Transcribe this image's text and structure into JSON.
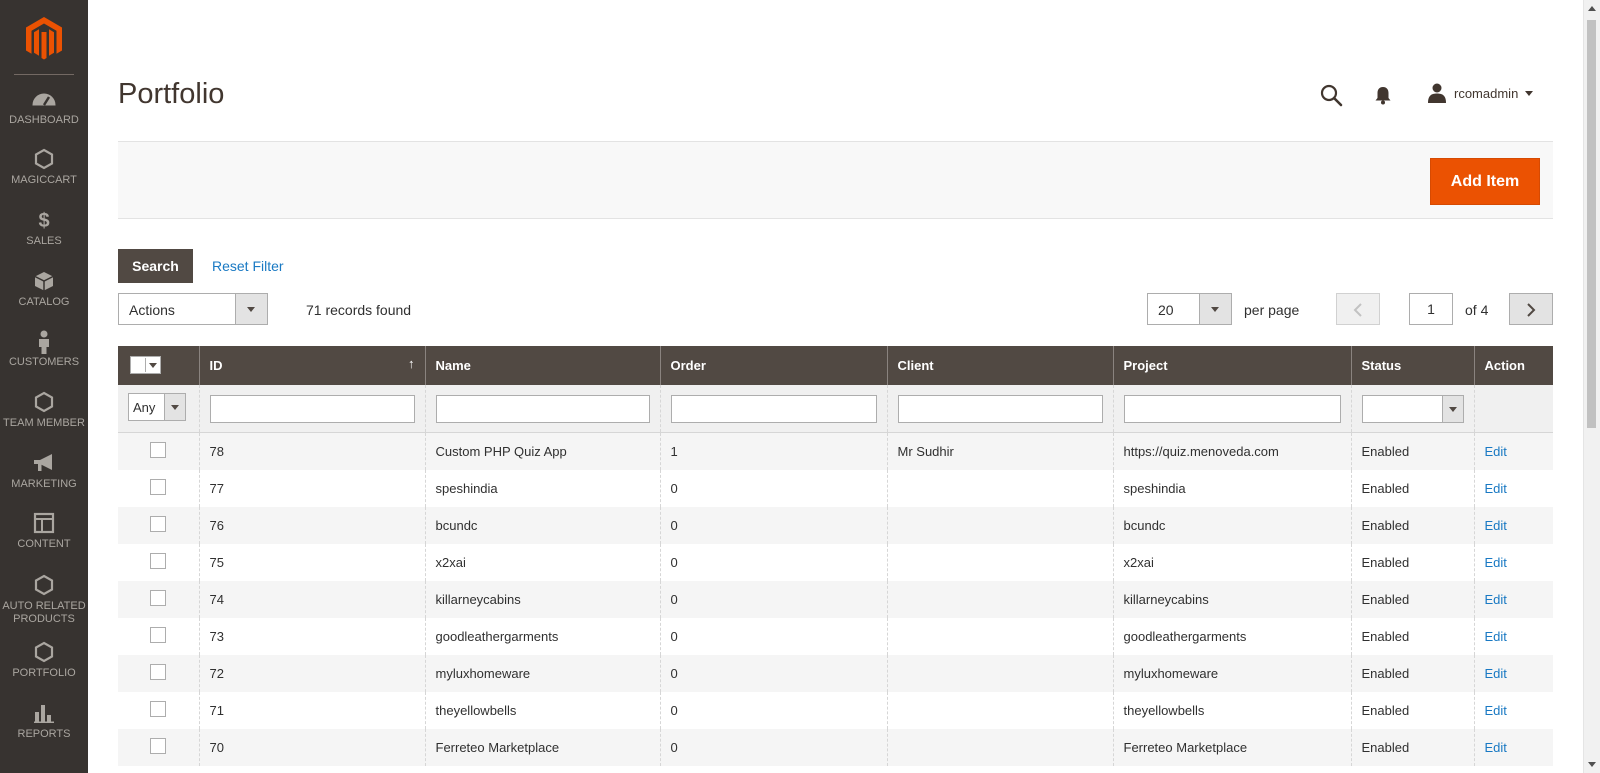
{
  "sidebar": {
    "items": [
      {
        "label": "DASHBOARD",
        "icon": "dashboard-icon"
      },
      {
        "label": "MAGICCART",
        "icon": "hexagon-icon"
      },
      {
        "label": "SALES",
        "icon": "dollar-icon"
      },
      {
        "label": "CATALOG",
        "icon": "box-icon"
      },
      {
        "label": "CUSTOMERS",
        "icon": "person-icon"
      },
      {
        "label": "TEAM MEMBER",
        "icon": "hexagon-icon"
      },
      {
        "label": "MARKETING",
        "icon": "megaphone-icon"
      },
      {
        "label": "CONTENT",
        "icon": "layout-icon"
      },
      {
        "label": "AUTO RELATED PRODUCTS",
        "icon": "hexagon-icon"
      },
      {
        "label": "PORTFOLIO",
        "icon": "hexagon-icon"
      },
      {
        "label": "REPORTS",
        "icon": "bar-chart-icon"
      }
    ]
  },
  "header": {
    "title": "Portfolio",
    "username": "rcomadmin"
  },
  "toolbar": {
    "add_label": "Add Item",
    "search_label": "Search",
    "reset_label": "Reset Filter",
    "actions_label": "Actions",
    "records": "71 records found",
    "per_page_value": "20",
    "per_page_label": "per page",
    "page": "1",
    "page_of": "of 4"
  },
  "grid": {
    "columns": [
      "ID",
      "Name",
      "Order",
      "Client",
      "Project",
      "Status",
      "Action"
    ],
    "filter_any": "Any",
    "rows": [
      {
        "id": "78",
        "name": "Custom PHP Quiz App",
        "order": "1",
        "client": "Mr Sudhir",
        "project": "https://quiz.menoveda.com",
        "status": "Enabled",
        "action": "Edit"
      },
      {
        "id": "77",
        "name": "speshindia",
        "order": "0",
        "client": "",
        "project": "speshindia",
        "status": "Enabled",
        "action": "Edit"
      },
      {
        "id": "76",
        "name": "bcundc",
        "order": "0",
        "client": "",
        "project": "bcundc",
        "status": "Enabled",
        "action": "Edit"
      },
      {
        "id": "75",
        "name": "x2xai",
        "order": "0",
        "client": "",
        "project": "x2xai",
        "status": "Enabled",
        "action": "Edit"
      },
      {
        "id": "74",
        "name": "killarneycabins",
        "order": "0",
        "client": "",
        "project": "killarneycabins",
        "status": "Enabled",
        "action": "Edit"
      },
      {
        "id": "73",
        "name": "goodleathergarments",
        "order": "0",
        "client": "",
        "project": "goodleathergarments",
        "status": "Enabled",
        "action": "Edit"
      },
      {
        "id": "72",
        "name": "myluxhomeware",
        "order": "0",
        "client": "",
        "project": "myluxhomeware",
        "status": "Enabled",
        "action": "Edit"
      },
      {
        "id": "71",
        "name": "theyellowbells",
        "order": "0",
        "client": "",
        "project": "theyellowbells",
        "status": "Enabled",
        "action": "Edit"
      },
      {
        "id": "70",
        "name": "Ferreteo Marketplace",
        "order": "0",
        "client": "",
        "project": "Ferreteo Marketplace",
        "status": "Enabled",
        "action": "Edit"
      }
    ]
  }
}
